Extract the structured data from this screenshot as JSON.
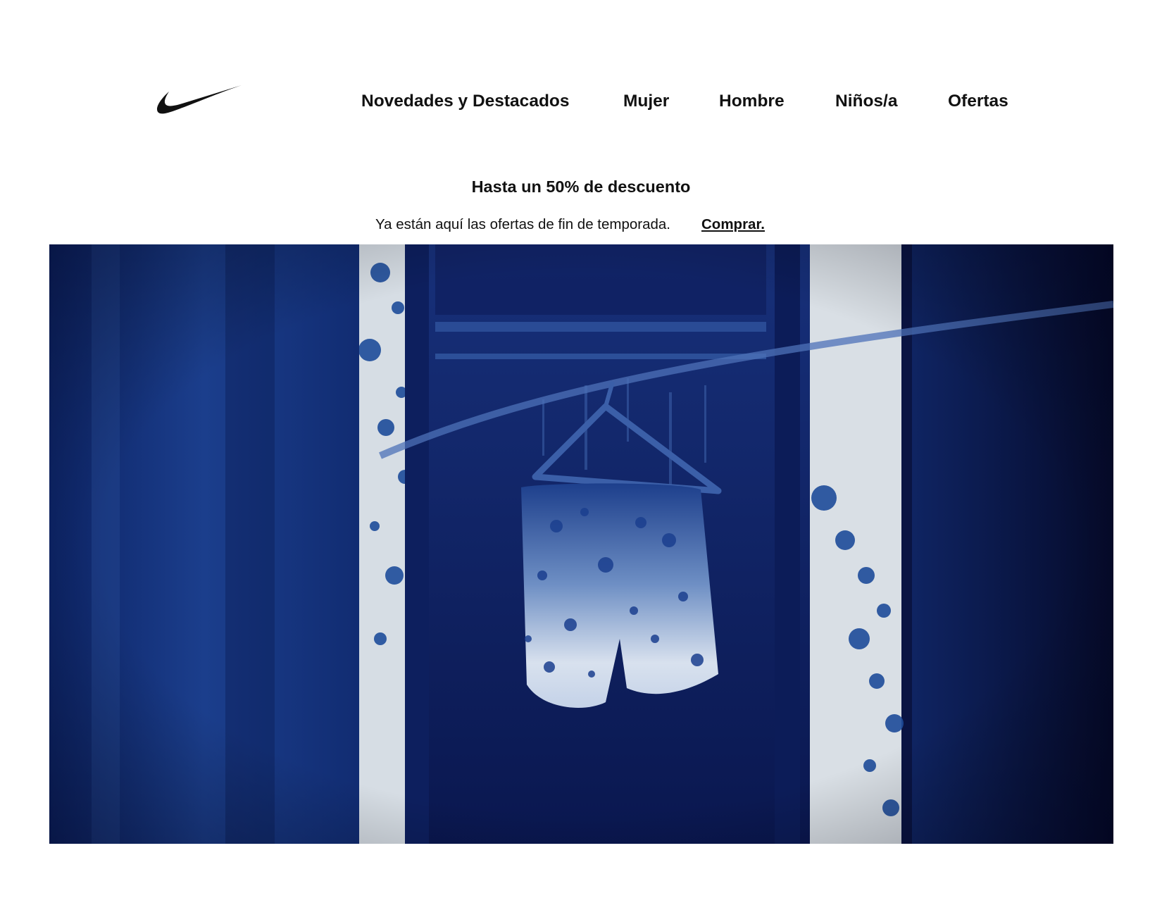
{
  "brand": {
    "logo_icon": "swoosh-logo-icon",
    "color": "#111111"
  },
  "nav": {
    "items": [
      {
        "label": "Novedades y Destacados"
      },
      {
        "label": "Mujer"
      },
      {
        "label": "Hombre"
      },
      {
        "label": "Niños/a"
      },
      {
        "label": "Ofertas"
      }
    ]
  },
  "promo": {
    "title": "Hasta un 50% de descuento",
    "text": "Ya están aquí las ofertas de fin de temporada.",
    "link": "Comprar."
  },
  "hero": {
    "colors": {
      "deep": "#0b1445",
      "mid": "#15307a",
      "light": "#d9dfe6"
    }
  }
}
